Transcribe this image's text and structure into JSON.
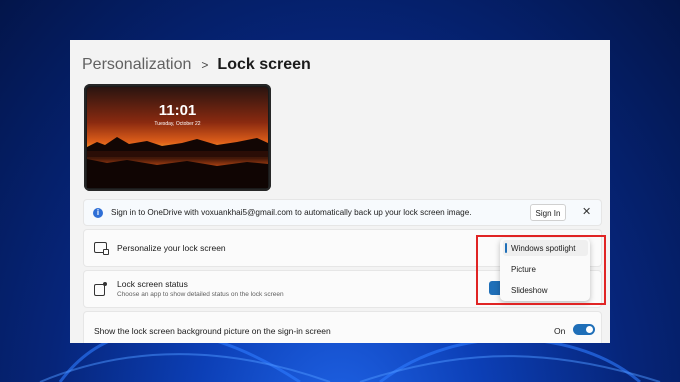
{
  "breadcrumb": {
    "parent": "Personalization",
    "separator": ">",
    "current": "Lock screen"
  },
  "preview": {
    "time": "11:01",
    "date": "Tuesday, October 22"
  },
  "banner": {
    "icon": "info-icon",
    "text": "Sign in to OneDrive with voxuankhai5@gmail.com to automatically back up your lock screen image.",
    "sign_in_label": "Sign In",
    "close_glyph": "✕"
  },
  "personalize": {
    "title": "Personalize your lock screen",
    "icon": "lock-screen-icon"
  },
  "dropdown": {
    "options": [
      "Windows spotlight",
      "Picture",
      "Slideshow"
    ],
    "selected": "Windows spotlight"
  },
  "status": {
    "title": "Lock screen status",
    "subtitle": "Choose an app to show detailed status on the lock screen",
    "icon": "status-icon"
  },
  "background_setting": {
    "title": "Show the lock screen background picture on the sign-in screen",
    "toggle_label": "On",
    "toggle_on": true
  },
  "colors": {
    "accent": "#1f6fb8",
    "highlight": "#e02424",
    "info": "#2f6fd6"
  }
}
